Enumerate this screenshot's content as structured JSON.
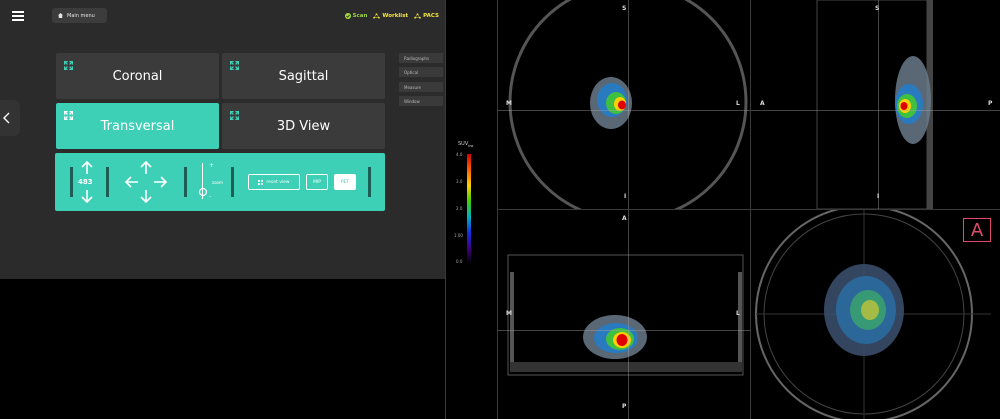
{
  "menu": {
    "main_menu_label": "Main menu"
  },
  "status": {
    "scan": "Scan",
    "worklist": "Worklist",
    "pacs": "PACS"
  },
  "views": [
    {
      "label": "Coronal",
      "active": false
    },
    {
      "label": "Sagittal",
      "active": false
    },
    {
      "label": "Transversal",
      "active": true
    },
    {
      "label": "3D View",
      "active": false
    }
  ],
  "controls": {
    "slice_number": "483",
    "plus": "+",
    "minus": "-",
    "zoom_label": "zoom",
    "reset_view": "reset view",
    "mip": "MIP",
    "pet": "PET"
  },
  "side_menu": [
    "Radiographs",
    "Optical",
    "Measure",
    "Window"
  ],
  "colorbar": {
    "title": "SUV",
    "title_sub": "bw",
    "ticks": [
      "4.0",
      "3.0",
      "2.0",
      "1.00",
      "0.0"
    ],
    "colors": [
      "#d00000",
      "#ff6000",
      "#ffd000",
      "#40d000",
      "#00b0c0",
      "#1030e0",
      "#400080",
      "#000000"
    ]
  },
  "orientation": {
    "coronal": {
      "top": "S",
      "bottom": "I",
      "left": "M",
      "right": "L"
    },
    "sagittal": {
      "top": "S",
      "bottom": "I",
      "left": "A",
      "right": "P"
    },
    "transversal": {
      "top": "A",
      "bottom": "P",
      "left": "M",
      "right": "L"
    },
    "marker_3d": "A"
  },
  "colors": {
    "accent": "#3ecfb7",
    "panel": "#2b2b2b",
    "status_yellow": "#f5e53a",
    "status_green": "#9ed53b"
  }
}
